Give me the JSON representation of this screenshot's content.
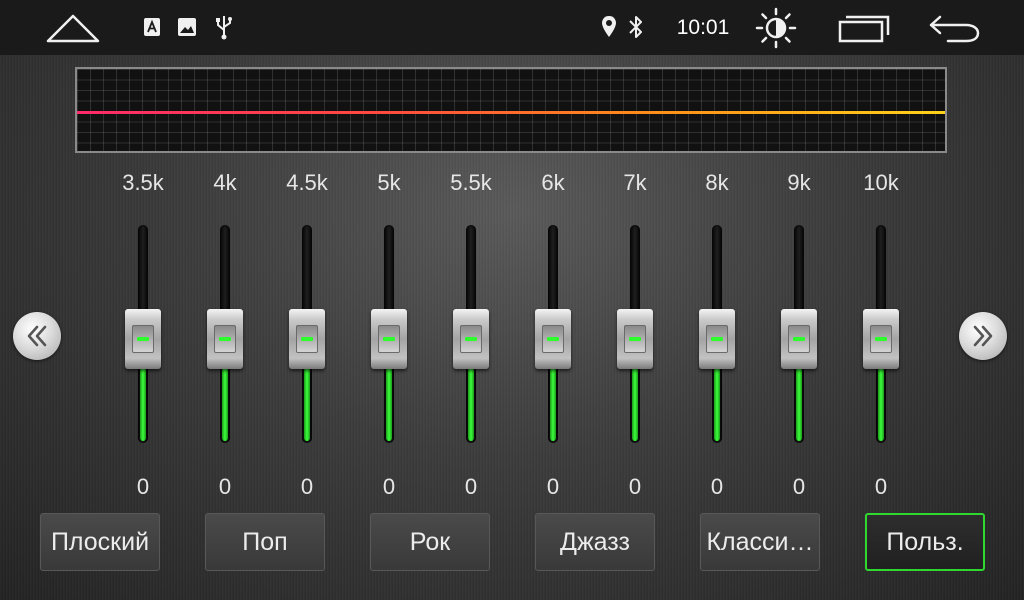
{
  "status_bar": {
    "time": "10:01",
    "icons": [
      "home-icon",
      "text-icon",
      "image-icon",
      "usb-icon",
      "location-icon",
      "bluetooth-icon",
      "brightness-icon",
      "recent-apps-icon",
      "back-icon"
    ]
  },
  "equalizer": {
    "curve_colors": [
      "#ff2a6a",
      "#ff8c1a",
      "#ffd21a"
    ],
    "bands": [
      {
        "freq": "3.5k",
        "value": "0",
        "level": 0.5
      },
      {
        "freq": "4k",
        "value": "0",
        "level": 0.5
      },
      {
        "freq": "4.5k",
        "value": "0",
        "level": 0.5
      },
      {
        "freq": "5k",
        "value": "0",
        "level": 0.5
      },
      {
        "freq": "5.5k",
        "value": "0",
        "level": 0.5
      },
      {
        "freq": "6k",
        "value": "0",
        "level": 0.5
      },
      {
        "freq": "7k",
        "value": "0",
        "level": 0.5
      },
      {
        "freq": "8k",
        "value": "0",
        "level": 0.5
      },
      {
        "freq": "9k",
        "value": "0",
        "level": 0.5
      },
      {
        "freq": "10k",
        "value": "0",
        "level": 0.5
      }
    ],
    "nav_prev_icon": "chevron-double-left-icon",
    "nav_next_icon": "chevron-double-right-icon"
  },
  "presets": [
    {
      "label": "Плоский",
      "active": false
    },
    {
      "label": "Поп",
      "active": false
    },
    {
      "label": "Рок",
      "active": false
    },
    {
      "label": "Джазз",
      "active": false
    },
    {
      "label": "Класси…",
      "active": false
    },
    {
      "label": "Польз.",
      "active": true
    }
  ],
  "colors": {
    "accent_green": "#2fd82f",
    "background": "#3a3a3a",
    "status_bar": "#1a1a1a"
  }
}
